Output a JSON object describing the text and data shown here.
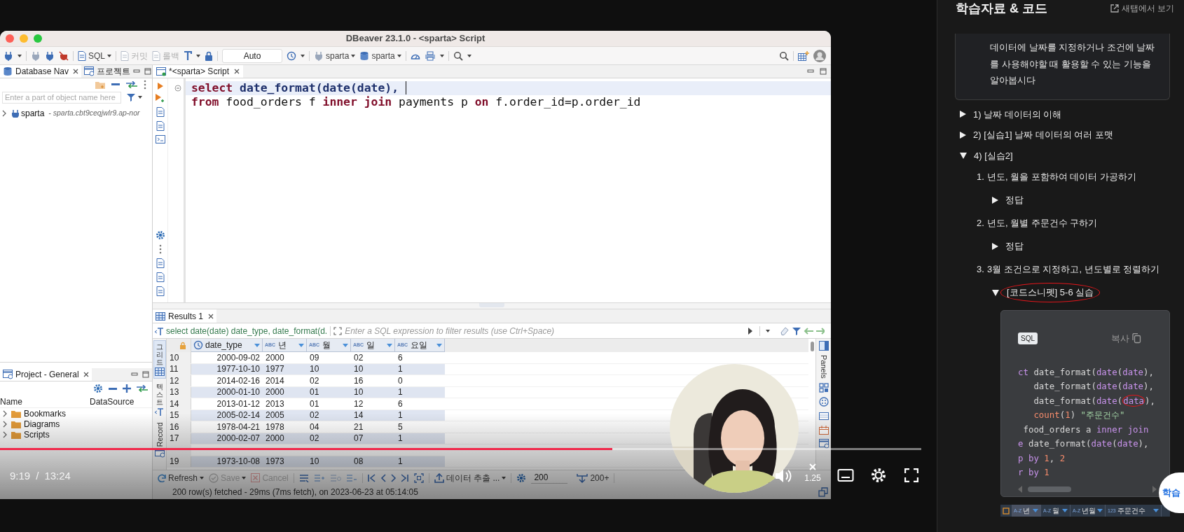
{
  "video": {
    "dbeaver": {
      "title": "DBeaver 23.1.0 - <sparta> Script",
      "toolbar": {
        "sql": "SQL",
        "commit": {
          "label": "커밋",
          "disabled": true
        },
        "rollback": {
          "label": "롤백",
          "disabled": true
        },
        "mode": "Auto",
        "datasource": "sparta",
        "schema": "sparta"
      },
      "navigator": {
        "tabs": [
          {
            "label": "Database Nav",
            "selected": true
          },
          {
            "label": "프로젝트",
            "selected": false
          }
        ],
        "filter_placeholder": "Enter a part of object name here",
        "tree": [
          {
            "label": "sparta",
            "detail": "- sparta.cbt9ceqjwlr9.ap-nor",
            "expanded": false
          }
        ]
      },
      "project": {
        "tab": "Project - General",
        "columns": [
          "Name",
          "DataSource"
        ],
        "items": [
          {
            "label": "Bookmarks",
            "expanded": false
          },
          {
            "label": "Diagrams",
            "expanded": false
          },
          {
            "label": "Scripts",
            "expanded": false
          }
        ]
      },
      "editor": {
        "tab": "*<sparta> Script",
        "lines": [
          {
            "highlighted": true,
            "foldable": true,
            "tokens": [
              {
                "text": "select",
                "kind": "keyword"
              },
              {
                "text": " date_format(date(date), ",
                "kind": "function",
                "cursor_after": true
              }
            ]
          },
          {
            "highlighted": false,
            "foldable": false,
            "tokens": [
              {
                "text": "from",
                "kind": "keyword",
                "cursor_after": false
              },
              {
                "text": " food_orders f ",
                "kind": "plain",
                "cursor_after": false
              },
              {
                "text": "inner join",
                "kind": "keyword",
                "cursor_after": false
              },
              {
                "text": " payments p ",
                "kind": "plain",
                "cursor_after": false
              },
              {
                "text": "on",
                "kind": "keyword",
                "cursor_after": false
              },
              {
                "text": " f.order_id=p.order_id",
                "kind": "plain",
                "cursor_after": false
              }
            ]
          }
        ]
      },
      "results": {
        "tab": "Results 1",
        "query": "select date(date) date_type, date_format(d.",
        "filter_placeholder": "Enter a SQL expression to filter results (use Ctrl+Space)",
        "side_tabs": [
          {
            "label": "그리드",
            "kind": "vertical",
            "selected": true
          },
          {
            "label": "텍스트",
            "kind": "vertical",
            "selected": false
          },
          {
            "label": "Record",
            "kind": "rotated",
            "selected": false
          }
        ],
        "panels_label": "Panels",
        "columns": [
          {
            "label": "date_type",
            "kind": "date"
          },
          {
            "label": "년",
            "kind": "string",
            "type_badge": "ABC"
          },
          {
            "label": "월",
            "kind": "string",
            "type_badge": "ABC"
          },
          {
            "label": "일",
            "kind": "string",
            "type_badge": "ABC"
          },
          {
            "label": "요일",
            "kind": "string",
            "type_badge": "ABC"
          }
        ],
        "rows": [
          {
            "number": "10",
            "cells": [
              "2000-09-02",
              "2000",
              "09",
              "02",
              "6"
            ]
          },
          {
            "number": "11",
            "cells": [
              "1977-10-10",
              "1977",
              "10",
              "10",
              "1"
            ]
          },
          {
            "number": "12",
            "cells": [
              "2014-02-16",
              "2014",
              "02",
              "16",
              "0"
            ]
          },
          {
            "number": "13",
            "cells": [
              "2000-01-10",
              "2000",
              "01",
              "10",
              "1"
            ]
          },
          {
            "number": "14",
            "cells": [
              "2013-01-12",
              "2013",
              "01",
              "12",
              "6"
            ]
          },
          {
            "number": "15",
            "cells": [
              "2005-02-14",
              "2005",
              "02",
              "14",
              "1"
            ]
          },
          {
            "number": "16",
            "cells": [
              "1978-04-21",
              "1978",
              "04",
              "21",
              "5"
            ]
          },
          {
            "number": "17",
            "cells": [
              "2000-02-07",
              "2000",
              "02",
              "07",
              "1"
            ]
          },
          {
            "kind": "obscured"
          },
          {
            "number": "19",
            "cells": [
              "1973-10-08",
              "1973",
              "10",
              "08",
              "1"
            ]
          }
        ],
        "actions": [
          {
            "label": "Refresh",
            "disabled": false
          },
          {
            "label": "Save",
            "disabled": true
          },
          {
            "label": "Cancel",
            "disabled": true
          }
        ],
        "export": "데이터 추출 ...",
        "fetch_size": "200",
        "fetch_all": "200+",
        "status": "200 row(s) fetched - 29ms (7ms fetch), on 2023-06-23 at 05:14:05"
      }
    },
    "player": {
      "progress": {
        "level": 0.665
      },
      "current_time": "9:19",
      "separator": "/",
      "duration": "13:24",
      "speed": "1.25"
    }
  },
  "panel": {
    "title": "학습자료 & 코드",
    "open_new_tab": "새탭에서 보기",
    "intro": "데이터에 날짜를 지정하거나 조건에 날짜를 사용해야할 때 활용할 수 있는 기능을 알아봅시다",
    "outline": [
      {
        "kind": "toggle",
        "label": "1) 날짜 데이터의 이해",
        "expanded": false,
        "annotated": false
      },
      {
        "kind": "toggle",
        "label": "2) [실습1] 날짜 데이터의 여러 포맷",
        "expanded": false,
        "annotated": false
      },
      {
        "kind": "toggle",
        "label": "4) [실습2]",
        "expanded": true,
        "annotated": false,
        "children": [
          {
            "kind": "numbered",
            "number": "1.",
            "label": "년도, 월을 포함하여 데이터 가공하기",
            "children": [
              {
                "kind": "toggle",
                "label": "정답",
                "expanded": false,
                "annotated": false
              }
            ]
          },
          {
            "kind": "numbered",
            "number": "2.",
            "label": "년도, 월별 주문건수 구하기",
            "children": [
              {
                "kind": "toggle",
                "label": "정답",
                "expanded": false,
                "annotated": false
              }
            ]
          },
          {
            "kind": "numbered",
            "number": "3.",
            "label": "3월 조건으로 지정하고, 년도별로 정렬하기",
            "children": [
              {
                "kind": "toggle",
                "label": "[코드스니펫] 5-6 실습",
                "expanded": true,
                "annotated": true
              }
            ]
          }
        ]
      }
    ],
    "code": {
      "language": "SQL",
      "copy_label": "복사",
      "lines": [
        [
          {
            "text": "ct",
            "kind": "keyword"
          },
          {
            "text": " date_format(",
            "kind": "plain"
          },
          {
            "text": "date",
            "kind": "keyword"
          },
          {
            "text": "(",
            "kind": "plain"
          },
          {
            "text": "date",
            "kind": "keyword"
          },
          {
            "text": "),",
            "kind": "plain"
          }
        ],
        [
          {
            "text": "   date_format(",
            "kind": "plain"
          },
          {
            "text": "date",
            "kind": "keyword"
          },
          {
            "text": "(",
            "kind": "plain"
          },
          {
            "text": "date",
            "kind": "keyword"
          },
          {
            "text": "),",
            "kind": "plain"
          }
        ],
        [
          {
            "text": "   date_format(",
            "kind": "plain"
          },
          {
            "text": "date",
            "kind": "keyword"
          },
          {
            "text": "(",
            "kind": "plain"
          },
          {
            "text": "data",
            "kind": "keyword",
            "circled": true
          },
          {
            "text": "),",
            "kind": "plain"
          }
        ],
        [
          {
            "text": "   count",
            "kind": "builtin"
          },
          {
            "text": "(",
            "kind": "plain"
          },
          {
            "text": "1",
            "kind": "number"
          },
          {
            "text": ") ",
            "kind": "plain"
          },
          {
            "text": "\"주문건수\"",
            "kind": "string"
          }
        ],
        [
          {
            "text": " food_orders a ",
            "kind": "plain"
          },
          {
            "text": "inner join",
            "kind": "keyword"
          }
        ],
        [
          {
            "text": "e",
            "kind": "keyword"
          },
          {
            "text": " date_format(",
            "kind": "plain"
          },
          {
            "text": "date",
            "kind": "keyword"
          },
          {
            "text": "(",
            "kind": "plain"
          },
          {
            "text": "date",
            "kind": "keyword"
          },
          {
            "text": "),",
            "kind": "plain"
          }
        ],
        [
          {
            "text": "p by",
            "kind": "keyword"
          },
          {
            "text": " 1",
            "kind": "number"
          },
          {
            "text": ", ",
            "kind": "plain"
          },
          {
            "text": "2",
            "kind": "number"
          }
        ],
        [
          {
            "text": "r by",
            "kind": "keyword"
          },
          {
            "text": " 1",
            "kind": "number"
          }
        ]
      ]
    },
    "table_peek": {
      "columns": [
        {
          "badge": "A-Z",
          "label": "년",
          "selected": true
        },
        {
          "badge": "A-Z",
          "label": "월",
          "selected": false
        },
        {
          "badge": "A-Z",
          "label": "년월",
          "selected": false
        },
        {
          "badge": "123",
          "label": "주문건수",
          "selected": false
        }
      ]
    },
    "help_bubble": "학습"
  }
}
